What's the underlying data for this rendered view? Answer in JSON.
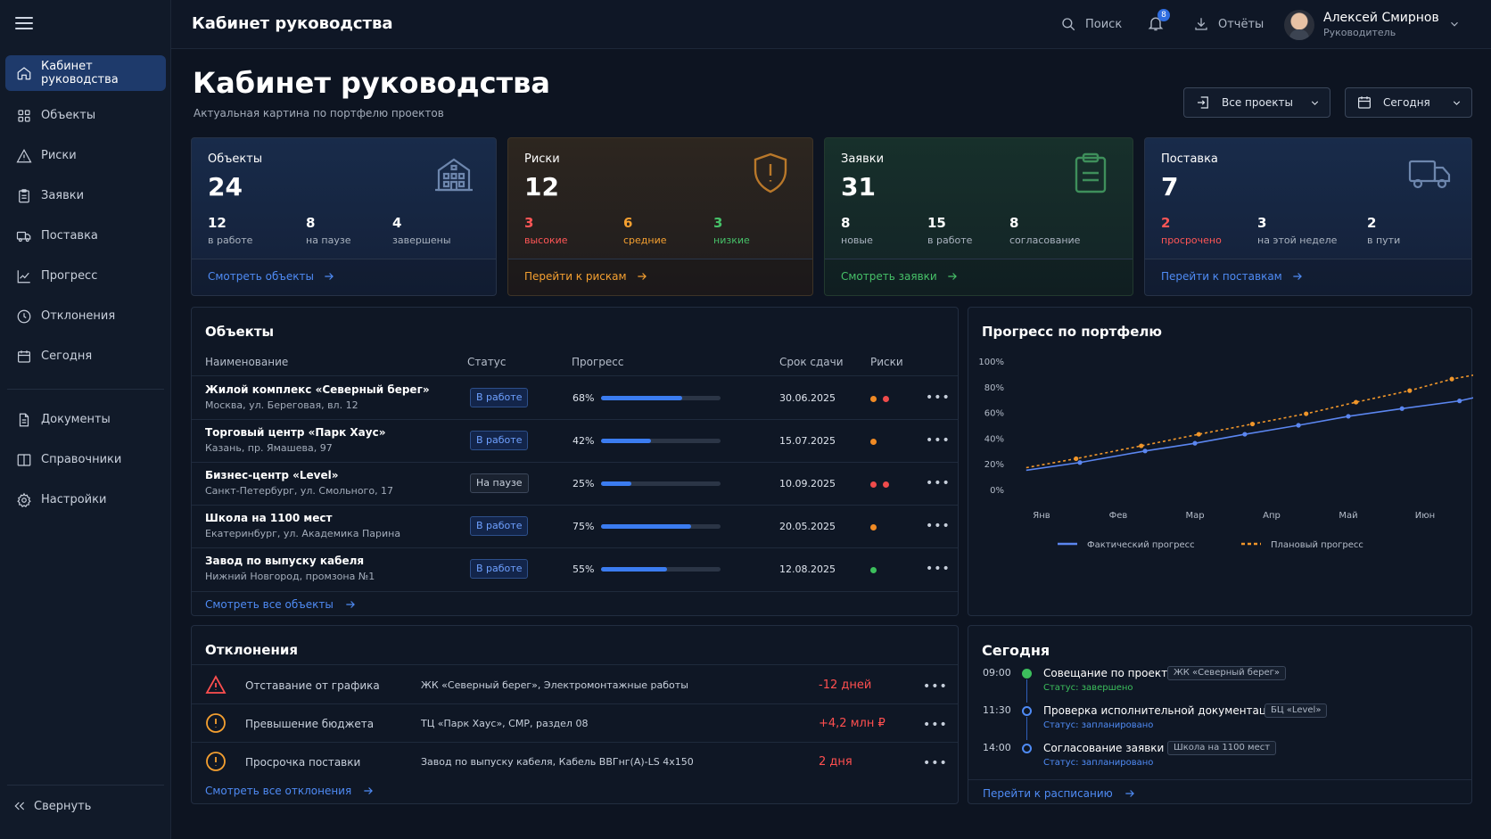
{
  "app": {
    "title": "Кабинет руководства",
    "accent": "#3b7cf0"
  },
  "sidebar": {
    "items": [
      {
        "label": "Кабинет руководства",
        "icon": "home-icon",
        "active": true
      },
      {
        "label": "Объекты",
        "icon": "grid-icon"
      },
      {
        "label": "Риски",
        "icon": "warning-icon"
      },
      {
        "label": "Заявки",
        "icon": "clipboard-icon"
      },
      {
        "label": "Поставка",
        "icon": "truck-icon"
      },
      {
        "label": "Прогресс",
        "icon": "chart-icon"
      },
      {
        "label": "Отклонения",
        "icon": "clock-icon"
      },
      {
        "label": "Сегодня",
        "icon": "calendar-icon"
      }
    ],
    "secondary": [
      {
        "label": "Документы",
        "icon": "document-icon"
      },
      {
        "label": "Справочники",
        "icon": "book-icon"
      },
      {
        "label": "Настройки",
        "icon": "gear-icon"
      }
    ],
    "collapse_label": "Свернуть"
  },
  "topbar": {
    "search_label": "Поиск",
    "notifications_count": "8",
    "reports_label": "Отчёты",
    "user_name": "Алексей Смирнов",
    "user_role": "Руководитель"
  },
  "header": {
    "title": "Кабинет руководства",
    "subtitle": "Актуальная картина по портфелю проектов",
    "project_filter": "Все проекты",
    "date_filter": "Сегодня"
  },
  "cards": [
    {
      "label": "Объекты",
      "value": "24",
      "icon": "building-icon",
      "subs": [
        {
          "v": "12",
          "l": "в работе"
        },
        {
          "v": "8",
          "l": "на паузе"
        },
        {
          "v": "4",
          "l": "завершены"
        }
      ],
      "link": "Смотреть объекты"
    },
    {
      "label": "Риски",
      "value": "12",
      "icon": "shield-alert-icon",
      "subs": [
        {
          "v": "3",
          "l": "высокие"
        },
        {
          "v": "6",
          "l": "средние"
        },
        {
          "v": "3",
          "l": "низкие"
        }
      ],
      "link": "Перейти к рискам"
    },
    {
      "label": "Заявки",
      "value": "31",
      "icon": "clipboard-icon",
      "subs": [
        {
          "v": "8",
          "l": "новые"
        },
        {
          "v": "15",
          "l": "в работе"
        },
        {
          "v": "8",
          "l": "согласование"
        }
      ],
      "link": "Смотреть заявки"
    },
    {
      "label": "Поставка",
      "value": "7",
      "icon": "truck-icon",
      "subs": [
        {
          "v": "2",
          "l": "просрочено"
        },
        {
          "v": "3",
          "l": "на этой неделе"
        },
        {
          "v": "2",
          "l": "в пути"
        }
      ],
      "link": "Перейти к поставкам"
    }
  ],
  "objects": {
    "title": "Объекты",
    "columns": [
      "Наименование",
      "Статус",
      "Прогресс",
      "Срок сдачи",
      "Риски"
    ],
    "rows": [
      {
        "name": "Жилой комплекс «Северный берег»",
        "address": "Москва, ул. Береговая, вл. 12",
        "status": "В работе",
        "progress": "68%",
        "progress_value": 68,
        "due": "30.06.2025",
        "risks": [
          "#f08a24",
          "#ef4b4b"
        ]
      },
      {
        "name": "Торговый центр «Парк Хаус»",
        "address": "Казань, пр. Ямашева, 97",
        "status": "В работе",
        "progress": "42%",
        "progress_value": 42,
        "due": "15.07.2025",
        "risks": [
          "#f08a24"
        ]
      },
      {
        "name": "Бизнес-центр «Level»",
        "address": "Санкт-Петербург, ул. Смольного, 17",
        "status": "На паузе",
        "progress": "25%",
        "progress_value": 25,
        "due": "10.09.2025",
        "risks": [
          "#ef4b4b",
          "#ef4b4b"
        ]
      },
      {
        "name": "Школа на 1100 мест",
        "address": "Екатеринбург, ул. Академика Парина",
        "status": "В работе",
        "progress": "75%",
        "progress_value": 75,
        "due": "20.05.2025",
        "risks": [
          "#f08a24"
        ]
      },
      {
        "name": "Завод по выпуску кабеля",
        "address": "Нижний Новгород, промзона №1",
        "status": "В работе",
        "progress": "55%",
        "progress_value": 55,
        "due": "12.08.2025",
        "risks": [
          "#3cbf5c"
        ]
      }
    ],
    "view_all": "Смотреть все объекты"
  },
  "progress_panel": {
    "title": "Прогресс по портфелю"
  },
  "chart_data": {
    "type": "line",
    "title": "Прогресс по портфелю",
    "categories": [
      "Янв",
      "Фев",
      "Мар",
      "Апр",
      "Май",
      "Июн"
    ],
    "yticks": [
      "0%",
      "20%",
      "40%",
      "60%",
      "80%",
      "100%"
    ],
    "ylim": [
      0,
      100
    ],
    "x": [
      0,
      0.5,
      1,
      1.5,
      2,
      2.5,
      3,
      3.5,
      4,
      4.5,
      5,
      5.5
    ],
    "series": [
      {
        "name": "Фактический прогресс",
        "color": "#5b86f0",
        "style": "solid",
        "values": [
          15,
          21,
          30,
          36,
          43,
          50,
          57,
          63,
          69,
          75
        ],
        "x": [
          -0.2,
          0.5,
          1.35,
          2.0,
          2.65,
          3.35,
          4.0,
          4.7,
          5.45,
          5.9
        ]
      },
      {
        "name": "Плановый прогресс",
        "color": "#f0962a",
        "style": "dashed",
        "values": [
          17,
          24,
          34,
          43,
          51,
          59,
          68,
          77,
          86,
          92
        ],
        "x": [
          -0.2,
          0.45,
          1.3,
          2.05,
          2.75,
          3.45,
          4.1,
          4.8,
          5.35,
          5.9
        ]
      }
    ],
    "legend": "bottom"
  },
  "deviations": {
    "title": "Отклонения",
    "rows": [
      {
        "icon": "triangle-warning-icon",
        "type": "Отставание от графика",
        "object": "ЖК «Северный берег», Электромонтажные работы",
        "value": "-12 дней"
      },
      {
        "icon": "circle-alert-icon",
        "type": "Превышение бюджета",
        "object": "ТЦ «Парк Хаус», СМР, раздел 08",
        "value": "+4,2 млн ₽"
      },
      {
        "icon": "circle-alert-icon",
        "type": "Просрочка поставки",
        "object": "Завод по выпуску кабеля, Кабель ВВГнг(А)-LS 4х150",
        "value": "2 дня"
      }
    ],
    "view_all": "Смотреть все отклонения"
  },
  "today": {
    "title": "Сегодня",
    "events": [
      {
        "time": "09:00",
        "title": "Совещание по проекту",
        "tag": "ЖК «Северный берег»",
        "status": "Статус: завершено",
        "status_color": "#3cbf5c"
      },
      {
        "time": "11:30",
        "title": "Проверка исполнительной документации",
        "tag": "БЦ «Level»",
        "status": "Статус: запланировано",
        "status_color": "#4f8bf5"
      },
      {
        "time": "14:00",
        "title": "Согласование заявки",
        "tag": "Школа на 1100 мест",
        "status": "Статус: запланировано",
        "status_color": "#4f8bf5"
      }
    ],
    "link": "Перейти к расписанию"
  }
}
